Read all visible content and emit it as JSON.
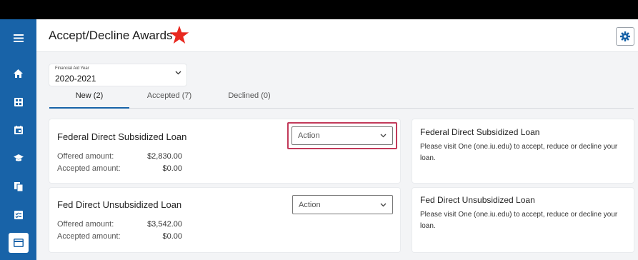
{
  "header": {
    "title": "Accept/Decline Awards"
  },
  "aid_year": {
    "label": "Financial Aid Year",
    "value": "2020-2021"
  },
  "tabs": [
    {
      "label": "New (2)"
    },
    {
      "label": "Accepted (7)"
    },
    {
      "label": "Declined (0)"
    }
  ],
  "awards": [
    {
      "name": "Federal Direct Subsidized Loan",
      "offered_label": "Offered amount:",
      "offered_value": "$2,830.00",
      "accepted_label": "Accepted amount:",
      "accepted_value": "$0.00",
      "action_label": "Action"
    },
    {
      "name": "Fed Direct Unsubsidized Loan",
      "offered_label": "Offered amount:",
      "offered_value": "$3,542.00",
      "accepted_label": "Accepted amount:",
      "accepted_value": "$0.00",
      "action_label": "Action"
    }
  ],
  "info_cards": [
    {
      "title": "Federal Direct Subsidized Loan",
      "body": "Please visit One (one.iu.edu) to accept, reduce or decline your loan."
    },
    {
      "title": "Fed Direct Unsubsidized Loan",
      "body": "Please visit One (one.iu.edu) to accept, reduce or decline your loan."
    }
  ],
  "sidebar": {
    "icons": [
      "menu-icon",
      "home-icon",
      "grid-icon",
      "calendar-icon",
      "graduation-cap-icon",
      "documents-icon",
      "checklist-icon",
      "card-icon"
    ]
  },
  "colors": {
    "sidebar": "#1863a8",
    "accent": "#1863a8",
    "star": "#e8281f",
    "highlight": "#c23a5a"
  }
}
